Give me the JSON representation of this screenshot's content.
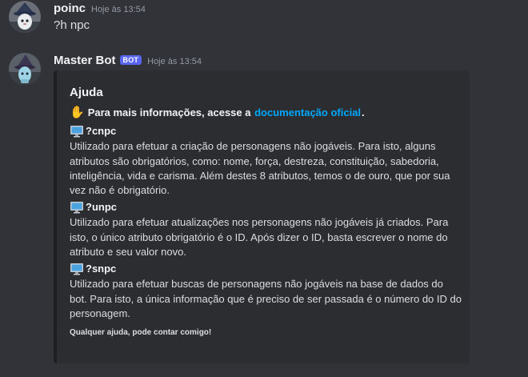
{
  "messages": {
    "user": {
      "username": "poinc",
      "timestamp": "Hoje às 13:54",
      "text": "?h npc"
    },
    "bot": {
      "username": "Master Bot",
      "badge": "BOT",
      "timestamp": "Hoje às 13:54"
    }
  },
  "embed": {
    "title": "Ajuda",
    "intro_emoji": "wave-icon",
    "intro_prefix": "Para mais informações, acesse a",
    "intro_link": "documentação oficial",
    "intro_suffix": ".",
    "commands": [
      {
        "icon": "monitor-icon",
        "name": "?cnpc",
        "description": "Utilizado para efetuar a criação de personagens não jogáveis. Para isto, alguns atributos são obrigatórios, como: nome, força, destreza, constituição, sabedoria, inteligência, vida e carisma. Além destes 8 atributos, temos o de ouro, que por sua vez não é obrigatório."
      },
      {
        "icon": "monitor-icon",
        "name": "?unpc",
        "description": "Utilizado para efetuar atualizações nos personagens não jogáveis já criados. Para isto, o único atributo obrigatório é o ID. Após dizer o ID, basta escrever o nome do atributo e seu valor novo."
      },
      {
        "icon": "monitor-icon",
        "name": "?snpc",
        "description": "Utilizado para efetuar buscas de personagens não jogáveis na base de dados do bot. Para isto, a única informação que é preciso de ser passada é o número do ID do personagem."
      }
    ],
    "footer": "Qualquer ajuda, pode contar comigo!"
  },
  "colors": {
    "background": "#313338",
    "embed_background": "#2b2d31",
    "link": "#00a8fc",
    "bot_badge": "#5865f2"
  }
}
